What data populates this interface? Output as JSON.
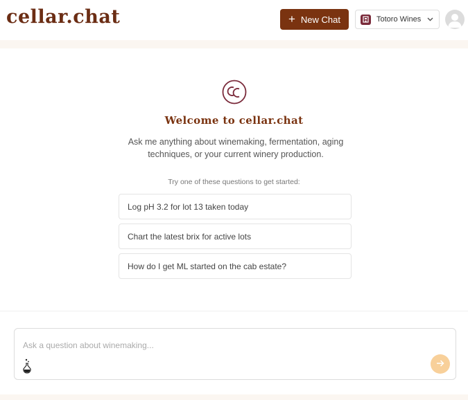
{
  "header": {
    "brand": "cellar.chat",
    "new_chat_label": "New Chat",
    "org_name": "Totoro Wines"
  },
  "main": {
    "welcome_title": "Welcome to cellar.chat",
    "intro_text": "Ask me anything about winemaking, fermentation, aging techniques, or your current winery production.",
    "try_label": "Try one of these questions to get started:",
    "suggestions": [
      "Log pH 3.2 for lot 13 taken today",
      "Chart the latest brix for active lots",
      "How do I get ML started on the cab estate?"
    ]
  },
  "composer": {
    "placeholder": "Ask a question about winemaking...",
    "value": ""
  },
  "icons": {
    "new_chat": "plus-icon",
    "org": "winery-badge-icon",
    "org_dropdown": "chevron-down-icon",
    "avatar": "user-avatar-icon",
    "logo": "cc-logo-icon",
    "tools": "flask-icon",
    "send": "arrow-right-icon"
  },
  "colors": {
    "brand": "#6b2d14",
    "primary_button": "#7a3310",
    "org_badge": "#7a2a3a",
    "send_button": "#f8d09a",
    "band": "#fbf6f1"
  }
}
